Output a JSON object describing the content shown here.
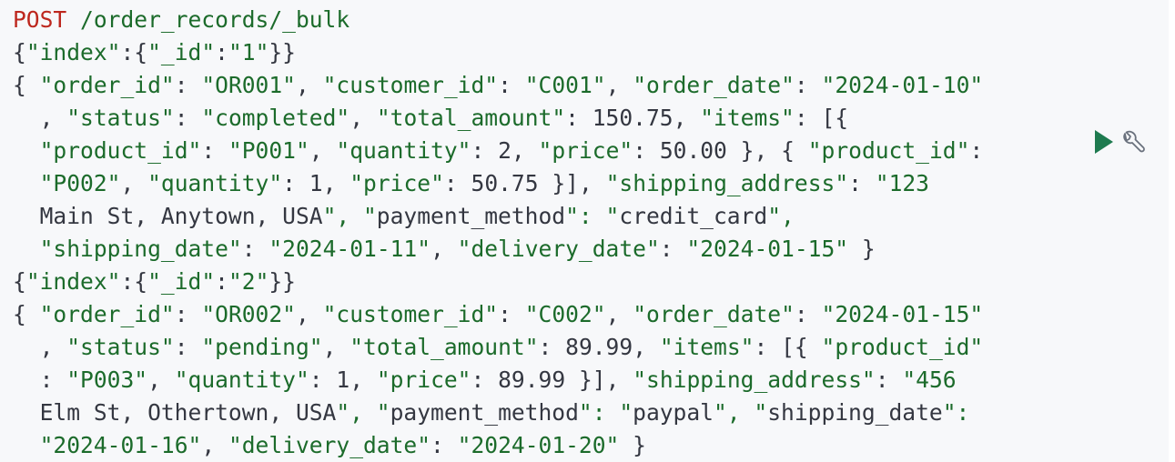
{
  "request": {
    "method": "POST",
    "path": " /order_records/_bulk"
  },
  "lines": [
    "{\"index\":{\"_id\":\"1\"}}",
    "{ \"order_id\": \"OR001\", \"customer_id\": \"C001\", \"order_date\": \"2024-01-10\"",
    "  , \"status\": \"completed\", \"total_amount\": 150.75, \"items\": [{",
    "  \"product_id\": \"P001\", \"quantity\": 2, \"price\": 50.00 }, { \"product_id\":",
    "  \"P002\", \"quantity\": 1, \"price\": 50.75 }], \"shipping_address\": \"123",
    "  Main St, Anytown, USA\", \"payment_method\": \"credit_card\",",
    "  \"shipping_date\": \"2024-01-11\", \"delivery_date\": \"2024-01-15\" }",
    "{\"index\":{\"_id\":\"2\"}}",
    "{ \"order_id\": \"OR002\", \"customer_id\": \"C002\", \"order_date\": \"2024-01-15\"",
    "  , \"status\": \"pending\", \"total_amount\": 89.99, \"items\": [{ \"product_id\"",
    "  : \"P003\", \"quantity\": 1, \"price\": 89.99 }], \"shipping_address\": \"456",
    "  Elm St, Othertown, USA\", \"payment_method\": \"paypal\", \"shipping_date\":",
    "  \"2024-01-16\", \"delivery_date\": \"2024-01-20\" }"
  ],
  "actions": {
    "run_icon": "play-icon",
    "settings_icon": "wrench-icon"
  },
  "colors": {
    "method": "#bd271e",
    "string": "#1c6b2b",
    "text": "#343741",
    "background": "#f7f8fa",
    "run_icon": "#1e7a4f",
    "wrench_icon": "#6a717d"
  }
}
